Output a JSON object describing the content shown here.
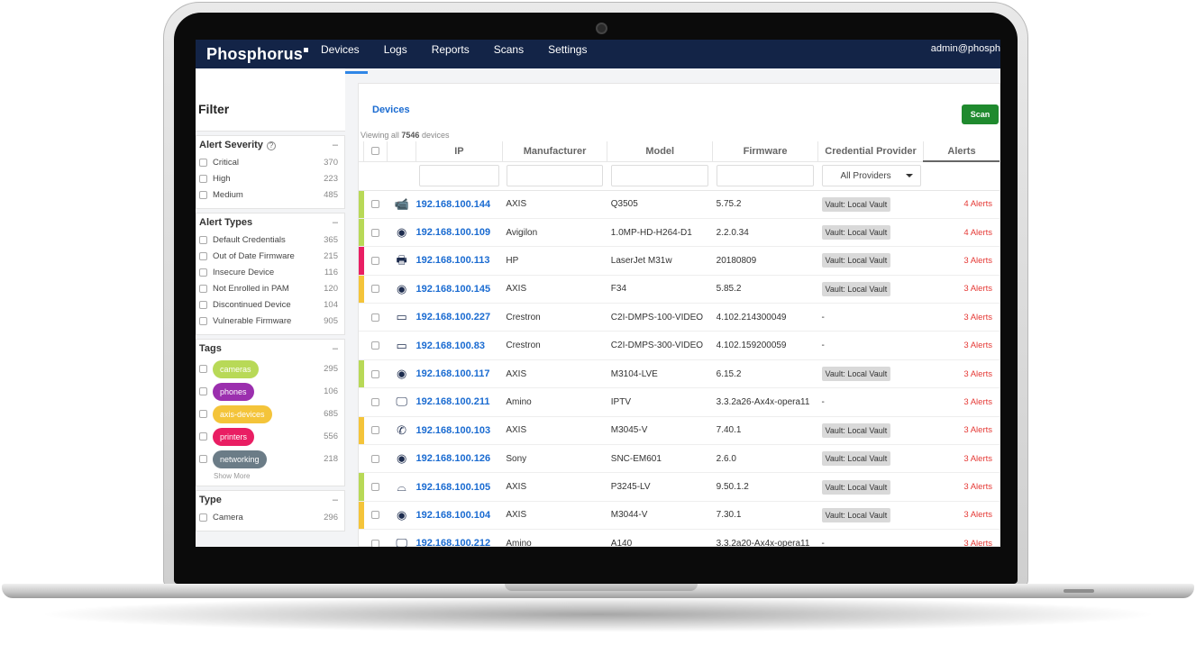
{
  "brand": {
    "name": "Phosphorus"
  },
  "nav": {
    "items": [
      "Devices",
      "Logs",
      "Reports",
      "Scans",
      "Settings"
    ],
    "active": "Devices"
  },
  "user": {
    "name": "admin@phosph"
  },
  "sidebar": {
    "title": "Filter",
    "alert_severity": {
      "title": "Alert Severity",
      "collapse": "–",
      "items": [
        {
          "label": "Critical",
          "count": "370"
        },
        {
          "label": "High",
          "count": "223"
        },
        {
          "label": "Medium",
          "count": "485"
        }
      ]
    },
    "alert_types": {
      "title": "Alert Types",
      "collapse": "–",
      "items": [
        {
          "label": "Default Credentials",
          "count": "365"
        },
        {
          "label": "Out of Date Firmware",
          "count": "215"
        },
        {
          "label": "Insecure Device",
          "count": "116"
        },
        {
          "label": "Not Enrolled in PAM",
          "count": "120"
        },
        {
          "label": "Discontinued Device",
          "count": "104"
        },
        {
          "label": "Vulnerable Firmware",
          "count": "905"
        }
      ]
    },
    "tags": {
      "title": "Tags",
      "collapse": "–",
      "show_more": "Show More",
      "items": [
        {
          "label": "cameras",
          "count": "295",
          "color": "#b8d957"
        },
        {
          "label": "phones",
          "count": "106",
          "color": "#9b2fae"
        },
        {
          "label": "axis-devices",
          "count": "685",
          "color": "#f4c43a"
        },
        {
          "label": "printers",
          "count": "556",
          "color": "#e91e63"
        },
        {
          "label": "networking",
          "count": "218",
          "color": "#6b7c87"
        }
      ]
    },
    "type": {
      "title": "Type",
      "collapse": "–",
      "items": [
        {
          "label": "Camera",
          "count": "296"
        }
      ]
    }
  },
  "main": {
    "title": "Devices",
    "scan_label": "Scan",
    "viewing_prefix": "Viewing all",
    "viewing_count": "7546",
    "viewing_suffix": "devices",
    "columns": [
      "IP",
      "Manufacturer",
      "Model",
      "Firmware",
      "Credential Provider",
      "Alerts"
    ],
    "provider_filter": "All Providers",
    "rows": [
      {
        "severity": "#b8d957",
        "icon": "camera-icon",
        "glyph": "📹",
        "ip": "192.168.100.144",
        "manufacturer": "AXIS",
        "model": "Q3505",
        "firmware": "5.75.2",
        "provider": "Vault: Local Vault",
        "alerts": "4 Alerts"
      },
      {
        "severity": "#b8d957",
        "icon": "webcam-icon",
        "glyph": "◉",
        "ip": "192.168.100.109",
        "manufacturer": "Avigilon",
        "model": "1.0MP-HD-H264-D1",
        "firmware": "2.2.0.34",
        "provider": "Vault: Local Vault",
        "alerts": "4 Alerts"
      },
      {
        "severity": "#e91e63",
        "icon": "printer-icon",
        "glyph": "🖶",
        "ip": "192.168.100.113",
        "manufacturer": "HP",
        "model": "LaserJet M31w",
        "firmware": "20180809",
        "provider": "Vault: Local Vault",
        "alerts": "3 Alerts"
      },
      {
        "severity": "#f4c43a",
        "icon": "webcam-icon",
        "glyph": "◉",
        "ip": "192.168.100.145",
        "manufacturer": "AXIS",
        "model": "F34",
        "firmware": "5.85.2",
        "provider": "Vault: Local Vault",
        "alerts": "3 Alerts"
      },
      {
        "severity": "",
        "icon": "network-device-icon",
        "glyph": "▭",
        "ip": "192.168.100.227",
        "manufacturer": "Crestron",
        "model": "C2I-DMPS-100-VIDEO",
        "firmware": "4.102.214300049",
        "provider": "-",
        "alerts": "3 Alerts"
      },
      {
        "severity": "",
        "icon": "network-device-icon",
        "glyph": "▭",
        "ip": "192.168.100.83",
        "manufacturer": "Crestron",
        "model": "C2I-DMPS-300-VIDEO",
        "firmware": "4.102.159200059",
        "provider": "-",
        "alerts": "3 Alerts"
      },
      {
        "severity": "#b8d957",
        "icon": "webcam-icon",
        "glyph": "◉",
        "ip": "192.168.100.117",
        "manufacturer": "AXIS",
        "model": "M3104-LVE",
        "firmware": "6.15.2",
        "provider": "Vault: Local Vault",
        "alerts": "3 Alerts"
      },
      {
        "severity": "",
        "icon": "monitor-icon",
        "glyph": "🖵",
        "ip": "192.168.100.211",
        "manufacturer": "Amino",
        "model": "IPTV",
        "firmware": "3.3.2a26-Ax4x-opera11",
        "provider": "-",
        "alerts": "3 Alerts"
      },
      {
        "severity": "#f4c43a",
        "icon": "phone-icon",
        "glyph": "✆",
        "ip": "192.168.100.103",
        "manufacturer": "AXIS",
        "model": "M3045-V",
        "firmware": "7.40.1",
        "provider": "Vault: Local Vault",
        "alerts": "3 Alerts"
      },
      {
        "severity": "",
        "icon": "webcam-icon",
        "glyph": "◉",
        "ip": "192.168.100.126",
        "manufacturer": "Sony",
        "model": "SNC-EM601",
        "firmware": "2.6.0",
        "provider": "Vault: Local Vault",
        "alerts": "3 Alerts"
      },
      {
        "severity": "#b8d957",
        "icon": "storage-icon",
        "glyph": "⌓",
        "ip": "192.168.100.105",
        "manufacturer": "AXIS",
        "model": "P3245-LV",
        "firmware": "9.50.1.2",
        "provider": "Vault: Local Vault",
        "alerts": "3 Alerts"
      },
      {
        "severity": "#f4c43a",
        "icon": "webcam-icon",
        "glyph": "◉",
        "ip": "192.168.100.104",
        "manufacturer": "AXIS",
        "model": "M3044-V",
        "firmware": "7.30.1",
        "provider": "Vault: Local Vault",
        "alerts": "3 Alerts"
      },
      {
        "severity": "",
        "icon": "monitor-icon",
        "glyph": "🖵",
        "ip": "192.168.100.212",
        "manufacturer": "Amino",
        "model": "A140",
        "firmware": "3.3.2a20-Ax4x-opera11",
        "provider": "-",
        "alerts": "3 Alerts"
      }
    ]
  }
}
